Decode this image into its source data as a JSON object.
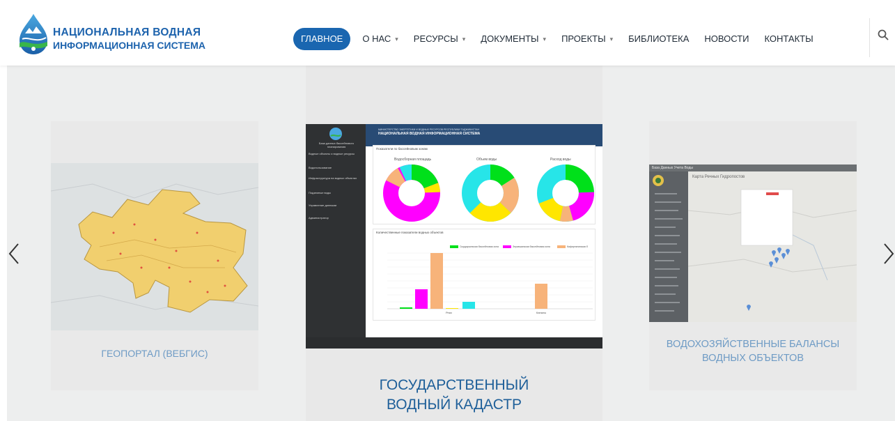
{
  "logo": {
    "line1": "НАЦИОНАЛЬНАЯ ВОДНАЯ",
    "line2": "ИНФОРМАЦИОННАЯ СИСТЕМА",
    "icon": "water-drop-icon"
  },
  "nav": {
    "items": [
      {
        "label": "ГЛАВНОЕ",
        "active": true,
        "dropdown": false
      },
      {
        "label": "О НАС",
        "active": false,
        "dropdown": true
      },
      {
        "label": "РЕСУРСЫ",
        "active": false,
        "dropdown": true
      },
      {
        "label": "ДОКУМЕНТЫ",
        "active": false,
        "dropdown": true
      },
      {
        "label": "ПРОЕКТЫ",
        "active": false,
        "dropdown": true
      },
      {
        "label": "БИБЛИОТЕКА",
        "active": false,
        "dropdown": false
      },
      {
        "label": "НОВОСТИ",
        "active": false,
        "dropdown": false
      },
      {
        "label": "КОНТАКТЫ",
        "active": false,
        "dropdown": false
      }
    ],
    "search_icon": "search-icon",
    "caret": "▾"
  },
  "slides": {
    "left": {
      "title": "ГЕОПОРТАЛ (ВЕБГИС)"
    },
    "center": {
      "title_line1": "ГОСУДАРСТВЕННЫЙ",
      "title_line2": "ВОДНЫЙ КАДАСТР",
      "dashboard": {
        "header_sub": "МИНИСТЕРСТВО ЭНЕРГЕТИКИ И ВОДНЫХ РЕСУРСОВ РЕСПУБЛИКИ ТАДЖИКИСТАН",
        "header_title": "НАЦИОНАЛЬНАЯ ВОДНАЯ ИНФОРМАЦИОННАЯ СИСТЕМА",
        "sidebar_brand": "База данных бассейнового планирования",
        "sidebar_items": [
          "Водные объекты и водные ресурсы",
          "Водопользование",
          "Инфраструктура на водных объектах",
          "Подземные воды",
          "Управление данными",
          "Администратор"
        ],
        "panel1_title": "Показатели по бассейновым зонам",
        "donut_titles": [
          "Водосборная площадь",
          "Объем воды",
          "Расход воды"
        ],
        "panel2_title": "Количественные показатели водных объектов",
        "legend": [
          "Сырдарьинская бассейновая зона",
          "Зеравшанская бассейновая зона",
          "Кафирниганская б"
        ],
        "bar_groups": [
          "Реки",
          "Каналы"
        ]
      }
    },
    "right": {
      "title_line1": "ВОДОХОЗЯЙСТВЕННЫЕ БАЛАНСЫ",
      "title_line2": "ВОДНЫХ ОБЪЕКТОВ",
      "map_header": "База Данных Учета Воды",
      "map_title": "Карта Речных Гидропостов"
    }
  },
  "slider": {
    "prev_icon": "chevron-left-icon",
    "next_icon": "chevron-right-icon"
  }
}
